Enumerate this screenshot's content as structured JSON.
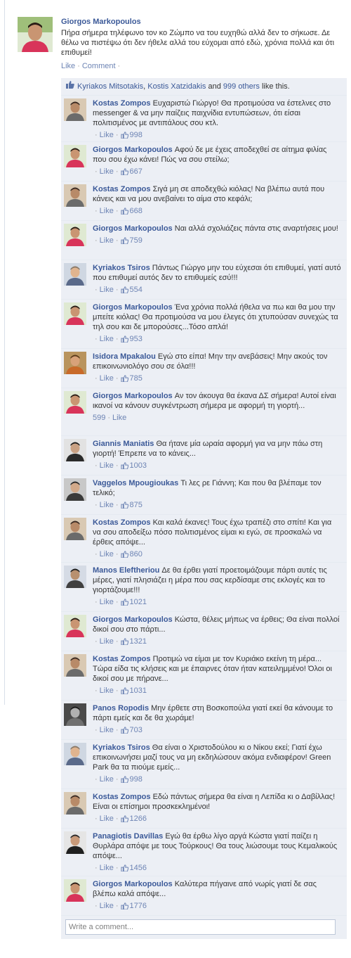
{
  "post": {
    "author": "Giorgos Markopoulos",
    "text": "Πήρα σήμερα τηλέφωνο τον κο Ζώμπο να του ευχηθώ αλλά δεν το σήκωσε. Δε θέλω να πιστέψω ότι δεν ήθελε αλλά του εύχομαι από εδώ, χρόνια πολλά και ότι επιθυμεί!",
    "actions": {
      "like": "Like",
      "comment": "Comment",
      "dot": "·"
    }
  },
  "likes_bar": {
    "name1": "Kyriakos Mitsotakis",
    "sep": ",",
    "name2": "Kostis Xatzidakis",
    "and": "and",
    "others": "999 others",
    "tail": "like this."
  },
  "comment_meta": {
    "dot": "·",
    "like": "Like"
  },
  "comments": [
    {
      "author": "Kostas Zompos",
      "text": "Ευχαριστώ Γιώργο! Θα προτιμούσα να έστελνες στο messenger & να μην παίζεις παιχνίδια εντυπώσεων, ότι είσαι πολιτισμένος με αντιπάλους σου κτλ.",
      "likes": "998",
      "avatar": "kz"
    },
    {
      "author": "Giorgos Markopoulos",
      "text": "Αφού δε με έχεις αποδεχθεί σε αίτημα φιλίας που σου έχω κάνει! Πώς να σου στείλω;",
      "likes": "667",
      "avatar": "gm"
    },
    {
      "author": "Kostas Zompos",
      "text": "Σιγά μη σε αποδεχθώ κιόλας! Να βλέπω αυτά που κάνεις και να μου ανεβαίνει το αίμα στο κεφάλι;",
      "likes": "668",
      "avatar": "kz"
    },
    {
      "author": "Giorgos Markopoulos",
      "text": "Ναι αλλά σχολιάζεις πάντα στις αναρτήσεις μου!",
      "likes": "759",
      "avatar": "gm"
    },
    {
      "author": "Kyriakos Tsiros",
      "text": "Πάντως Γιώργο μην του εύχεσαι ότι επιθυμεί, γιατί αυτό που επιθυμεί αυτός δεν το επιθυμείς εσύ!!!",
      "likes": "554",
      "avatar": "kt"
    },
    {
      "author": "Giorgos Markopoulos",
      "text": "Ένα χρόνια πολλά ήθελα να πω και θα μου την μπείτε κιόλας! Θα προτιμούσα να μου έλεγες ότι χτυπούσαν συνεχώς τα τηλ σου και δε μπορούσες...Τόσο απλά!",
      "likes": "953",
      "avatar": "gm"
    },
    {
      "author": "Isidora Mpakalou",
      "text": "Εγώ στο είπα! Μην την ανεβάσεις! Μην ακούς τον επικοινωνιολόγο σου σε όλα!!!",
      "likes": "785",
      "avatar": "im"
    },
    {
      "author": "Giorgos Markopoulos",
      "text": "Αν τον άκουγα θα έκανα ΔΣ σήμερα! Αυτοί είναι ικανοί να κάνουν συγκέντρωση σήμερα με αφορμή τη γιορτή...",
      "likes": "599",
      "avatar": "gm",
      "alt_meta": true
    },
    {
      "author": "Giannis Maniatis",
      "text": "Θα ήτανε μία ωραία αφορμή για να μην πάω στη γιορτή! Έπρεπε να το κάνεις...",
      "likes": "1003",
      "avatar": "gma"
    },
    {
      "author": "Vaggelos Mpougioukas",
      "text": "Τι λες ρε Γιάννη; Και που θα βλέπαμε τον τελικό;",
      "likes": "875",
      "avatar": "vm"
    },
    {
      "author": "Kostas Zompos",
      "text": "Και καλά έκανες! Τους έχω τραπέζι στο σπίτι! Και για να σου αποδείξω πόσο πολιτισμένος είμαι κι εγώ, σε προσκαλώ να έρθεις απόψε...",
      "likes": "860",
      "avatar": "kz"
    },
    {
      "author": "Manos Eleftheriou",
      "text": "Δε θα έρθει γιατί προετοιμάζουμε πάρτι αυτές τις μέρες, γιατί πλησιάζει η μέρα που σας κερδίσαμε στις εκλογές και το γιορτάζουμε!!!",
      "likes": "1021",
      "avatar": "me"
    },
    {
      "author": "Giorgos Markopoulos",
      "text": "Κώστα, θέλεις μήπως να έρθεις; Θα είναι πολλοί δικοί σου στο πάρτι...",
      "likes": "1321",
      "avatar": "gm"
    },
    {
      "author": "Kostas Zompos",
      "text": "Προτιμώ να είμαι με τον Κυριάκο εκείνη τη μέρα... Τώρα είδα τις κλήσεις και με έπαιρνες όταν ήταν κατειλημμένο! Όλοι οι δικοί σου με πήρανε...",
      "likes": "1031",
      "avatar": "kz"
    },
    {
      "author": "Panos Ropodis",
      "text": "Μην έρθετε στη Βοσκοπούλα γιατί εκεί θα κάνουμε το πάρτι εμείς και δε θα χωράμε!",
      "likes": "703",
      "avatar": "pr"
    },
    {
      "author": "Kyriakos Tsiros",
      "text": "Θα είναι ο Χριστοδούλου κι ο Νίκου εκεί; Γιατί έχω επικοινωνήσει μαζί τους να μη εκδηλώσουν ακόμα ενδιαφέρον! Green Park θα τα πιούμε εμείς...",
      "likes": "998",
      "avatar": "kt"
    },
    {
      "author": "Kostas Zompos",
      "text": "Εδώ πάντως σήμερα θα είναι η Λεπίδα κι ο Δαβίλλας! Είναι οι επίσημοι προσκεκλημένοι!",
      "likes": "1266",
      "avatar": "kz"
    },
    {
      "author": "Panagiotis Davillas",
      "text": "Εγώ θα έρθω λίγο αργά Κώστα γιατί παίζει η Θυρλάρα απόψε με τους Τούρκους! Θα τους λιώσουμε τους Κεμαλικούς απόψε...",
      "likes": "1456",
      "avatar": "pd"
    },
    {
      "author": "Giorgos Markopoulos",
      "text": "Καλύτερα πήγαινε από νωρίς γιατί δε σας βλέπω καλά απόψε...",
      "likes": "1776",
      "avatar": "gm"
    }
  ],
  "write_comment": {
    "placeholder": "Write a comment..."
  },
  "colors": {
    "link": "#3b5998",
    "feedback_bg": "#eceff5",
    "muted": "#808080"
  }
}
